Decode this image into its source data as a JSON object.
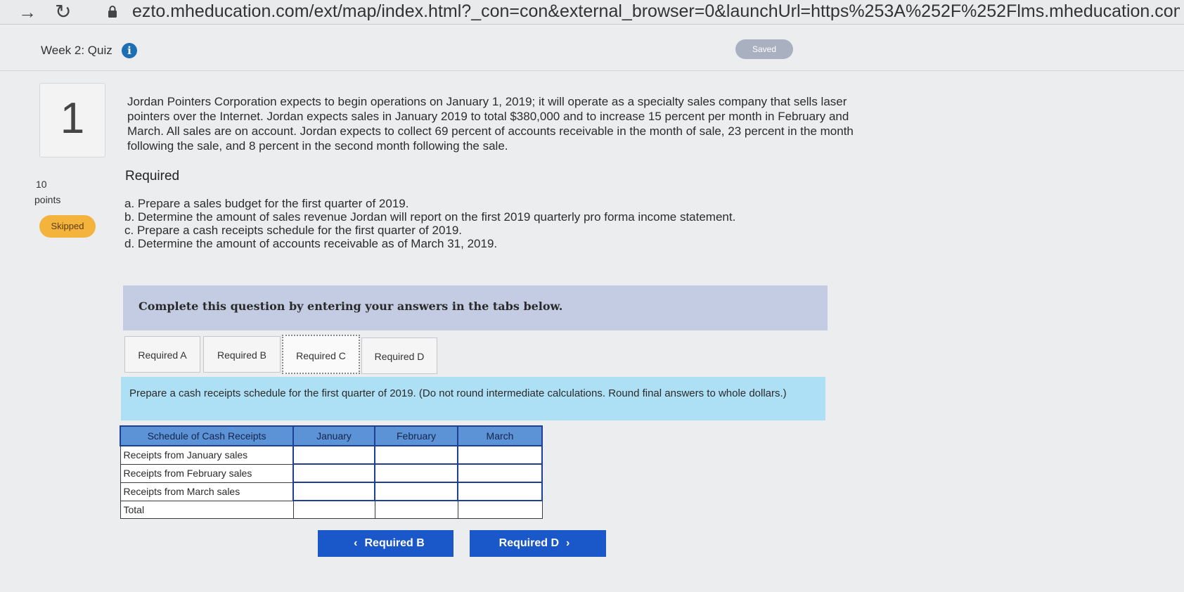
{
  "browser": {
    "url": "ezto.mheducation.com/ext/map/index.html?_con=con&external_browser=0&launchUrl=https%253A%252F%252Flms.mheducation.com%"
  },
  "header": {
    "quiz_title": "Week 2: Quiz",
    "saved_label": "Saved"
  },
  "question": {
    "number": "1",
    "points_value": "10",
    "points_label": "points",
    "status": "Skipped",
    "prompt": "Jordan Pointers Corporation expects to begin operations on January 1, 2019; it will operate as a specialty sales company that sells laser pointers over the Internet. Jordan expects sales in January 2019 to total $380,000 and to increase 15 percent per month in February and March. All sales are on account. Jordan expects to collect 69 percent of accounts receivable in the month of sale, 23 percent in the month following the sale, and 8 percent in the second month following the sale.",
    "required_heading": "Required",
    "requirements": [
      "a. Prepare a sales budget for the first quarter of 2019.",
      "b. Determine the amount of sales revenue Jordan will report on the first 2019 quarterly pro forma income statement.",
      "c. Prepare a cash receipts schedule for the first quarter of 2019.",
      "d. Determine the amount of accounts receivable as of March 31, 2019."
    ]
  },
  "instruction": "Complete this question by entering your answers in the tabs below.",
  "tabs": [
    {
      "label": "Required A"
    },
    {
      "label": "Required B"
    },
    {
      "label": "Required C"
    },
    {
      "label": "Required D"
    }
  ],
  "active_tab": "Required C",
  "task": "Prepare a cash receipts schedule for the first quarter of 2019. (Do not round intermediate calculations. Round final answers to whole dollars.)",
  "schedule": {
    "headers": [
      "Schedule of Cash Receipts",
      "January",
      "February",
      "March"
    ],
    "rows": [
      {
        "label": "Receipts from January sales",
        "values": [
          "",
          "",
          ""
        ]
      },
      {
        "label": "Receipts from February sales",
        "values": [
          "",
          "",
          ""
        ]
      },
      {
        "label": "Receipts from March sales",
        "values": [
          "",
          "",
          ""
        ]
      },
      {
        "label": "Total",
        "values": [
          "",
          "",
          ""
        ]
      }
    ]
  },
  "navigation": {
    "prev_label": "Required B",
    "next_label": "Required D"
  }
}
